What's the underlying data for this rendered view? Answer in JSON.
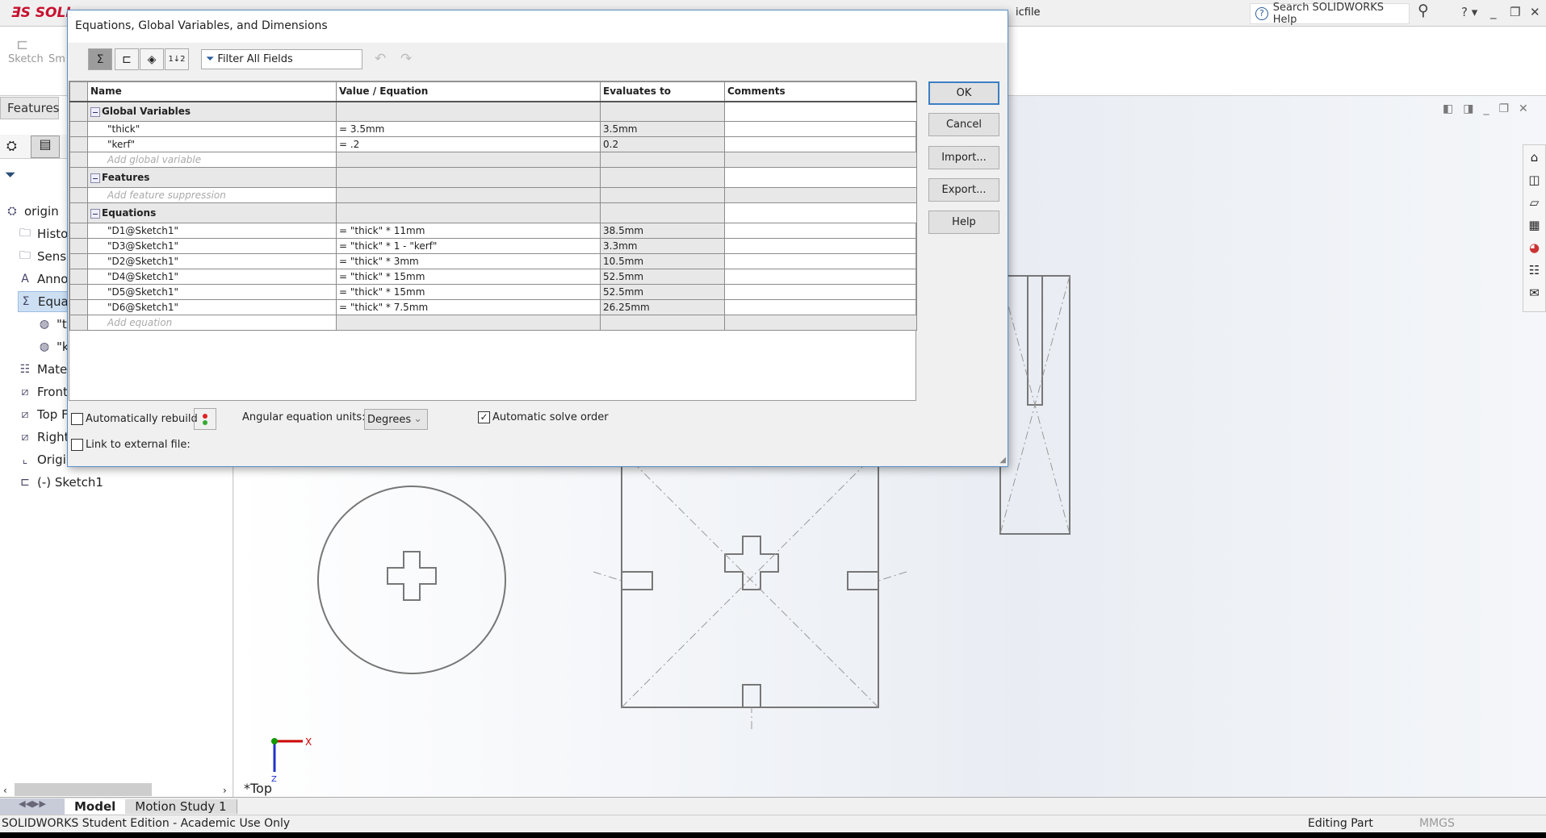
{
  "app": {
    "logo": "SOLI",
    "title_fragment": "icfile",
    "help_search_placeholder": "Search SOLIDWORKS Help",
    "help_icon": "?",
    "cmd_sketch": "Sketch",
    "cmd_smart": "Sm",
    "features_tab": "Features"
  },
  "tree": [
    {
      "label": "origin",
      "icon": "part-icon"
    },
    {
      "label": "Histo",
      "icon": "history-folder-icon"
    },
    {
      "label": "Senso",
      "icon": "sensors-folder-icon"
    },
    {
      "label": "Anno",
      "icon": "annotations-folder-icon"
    },
    {
      "label": "Equat",
      "icon": "equations-folder-icon"
    },
    {
      "label": "\"t",
      "icon": "globe-icon"
    },
    {
      "label": "\"k",
      "icon": "globe-icon"
    },
    {
      "label": "Mate",
      "icon": "material-icon"
    },
    {
      "label": "Front",
      "icon": "plane-icon"
    },
    {
      "label": "Top F",
      "icon": "plane-icon"
    },
    {
      "label": "Right",
      "icon": "plane-icon"
    },
    {
      "label": "Origi",
      "icon": "origin-icon"
    },
    {
      "label": "(-) Sketch1",
      "icon": "sketch-icon"
    }
  ],
  "dialog": {
    "title": "Equations, Global Variables, and Dimensions",
    "filter_placeholder": "Filter All Fields",
    "columns": [
      "Name",
      "Value / Equation",
      "Evaluates to",
      "Comments"
    ],
    "groups": {
      "global": "Global Variables",
      "features": "Features",
      "equations": "Equations"
    },
    "global_variables": [
      {
        "name": "\"thick\"",
        "value": "= 3.5mm",
        "evaluates": "3.5mm"
      },
      {
        "name": "\"kerf\"",
        "value": "= .2",
        "evaluates": "0.2"
      }
    ],
    "add_global": "Add global variable",
    "add_feature": "Add feature suppression",
    "equations": [
      {
        "name": "\"D1@Sketch1\"",
        "value": "= \"thick\" * 11mm",
        "evaluates": "38.5mm"
      },
      {
        "name": "\"D3@Sketch1\"",
        "value": "= \"thick\" * 1 - \"kerf\"",
        "evaluates": "3.3mm"
      },
      {
        "name": "\"D2@Sketch1\"",
        "value": "= \"thick\" * 3mm",
        "evaluates": "10.5mm"
      },
      {
        "name": "\"D4@Sketch1\"",
        "value": "= \"thick\" * 15mm",
        "evaluates": "52.5mm"
      },
      {
        "name": "\"D5@Sketch1\"",
        "value": "= \"thick\" * 15mm",
        "evaluates": "52.5mm"
      },
      {
        "name": "\"D6@Sketch1\"",
        "value": "= \"thick\" * 7.5mm",
        "evaluates": "26.25mm"
      }
    ],
    "add_equation": "Add equation",
    "buttons": {
      "ok": "OK",
      "cancel": "Cancel",
      "import": "Import...",
      "export": "Export...",
      "help": "Help"
    },
    "auto_rebuild": "Automatically rebuild",
    "auto_rebuild_checked": false,
    "link_external": "Link to external file:",
    "link_external_checked": false,
    "angular_label": "Angular equation units:",
    "angular_value": "Degrees",
    "auto_solve": "Automatic solve order",
    "auto_solve_checked": true
  },
  "view": {
    "name": "*Top",
    "axis_x": "X",
    "axis_z": "Z"
  },
  "bottom_tabs": {
    "model": "Model",
    "motion": "Motion Study 1"
  },
  "status": {
    "left": "SOLIDWORKS Student Edition - Academic Use Only",
    "editing": "Editing Part",
    "units": "MMGS"
  }
}
